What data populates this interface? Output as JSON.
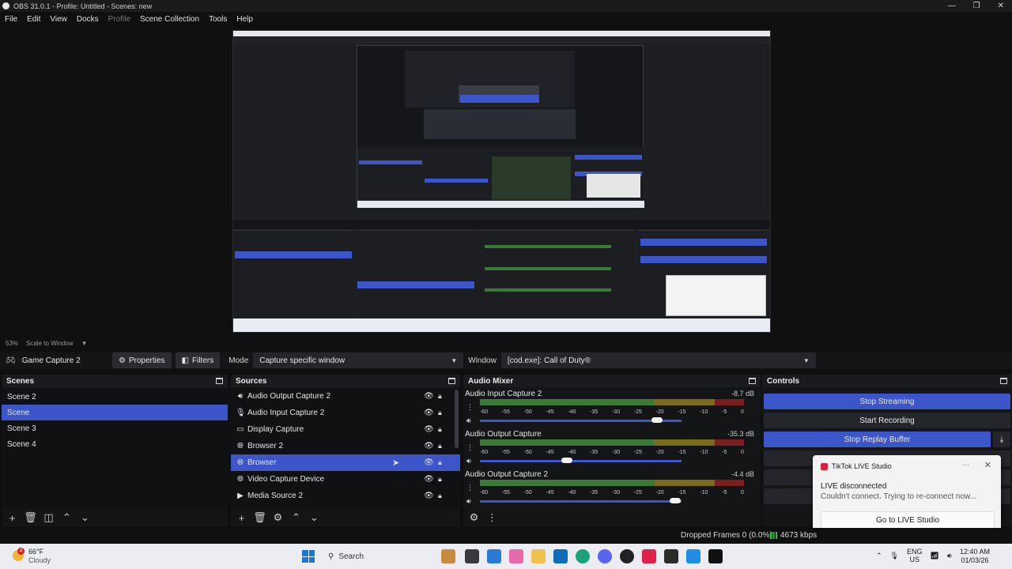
{
  "window": {
    "title": "OBS 31.0.1 - Profile: Untitled - Scenes: new",
    "controls": [
      "—",
      "❐",
      "✕"
    ]
  },
  "menu": [
    "File",
    "Edit",
    "View",
    "Docks",
    "Profile",
    "Scene Collection",
    "Tools",
    "Help"
  ],
  "preview_status": {
    "zoom": "53%",
    "mode": "Scale to Window"
  },
  "source_toolbar": {
    "source_name": "Game Capture 2",
    "properties_label": "Properties",
    "filters_label": "Filters",
    "mode_label": "Mode",
    "mode_value": "Capture specific window",
    "window_label": "Window",
    "window_value": "[cod.exe]: Call of Duty®"
  },
  "scenes": {
    "title": "Scenes",
    "items": [
      "Scene 2",
      "Scene",
      "Scene 3",
      "Scene 4"
    ],
    "selected": "Scene"
  },
  "sources": {
    "title": "Sources",
    "items": [
      {
        "name": "Audio Output Capture 2",
        "icon": "speaker-icon"
      },
      {
        "name": "Audio Input Capture 2",
        "icon": "microphone-icon"
      },
      {
        "name": "Display Capture",
        "icon": "monitor-icon"
      },
      {
        "name": "Browser 2",
        "icon": "globe-icon"
      },
      {
        "name": "Browser",
        "icon": "globe-icon"
      },
      {
        "name": "Video Capture Device",
        "icon": "camera-icon"
      },
      {
        "name": "Media Source 2",
        "icon": "play-icon"
      }
    ],
    "selected": "Browser"
  },
  "audio_mixer": {
    "title": "Audio Mixer",
    "channels": [
      {
        "name": "Audio Input Capture 2",
        "db": "-8.7 dB",
        "volume": 0.88
      },
      {
        "name": "Audio Output Capture",
        "db": "-35.3 dB",
        "volume": 0.43
      },
      {
        "name": "Audio Output Capture 2",
        "db": "-4.4 dB",
        "volume": 0.97
      }
    ],
    "ticks": [
      "-60",
      "-55",
      "-50",
      "-45",
      "-40",
      "-35",
      "-30",
      "-25",
      "-20",
      "-15",
      "-10",
      "-5",
      "0"
    ]
  },
  "controls": {
    "title": "Controls",
    "stop_streaming": "Stop Streaming",
    "start_recording": "Start Recording",
    "stop_replay": "Stop Replay Buffer"
  },
  "toast": {
    "app": "TikTok LIVE Studio",
    "more": "···",
    "title": "LIVE disconnected",
    "message": "Couldn't connect. Trying to re-connect now...",
    "button": "Go to LIVE Studio"
  },
  "status": {
    "dropped": "Dropped Frames 0 (0.0%)",
    "kbps": "4673 kbps"
  },
  "taskbar": {
    "weather_temp": "66°F",
    "weather_desc": "Cloudy",
    "weather_badge": "4",
    "search_label": "Search",
    "lang": "ENG",
    "region": "US",
    "time": "12:40 AM",
    "date": "01/03/26"
  },
  "colors": {
    "accent": "#3c55c9",
    "panel": "#141517",
    "background": "#0f0f10"
  }
}
